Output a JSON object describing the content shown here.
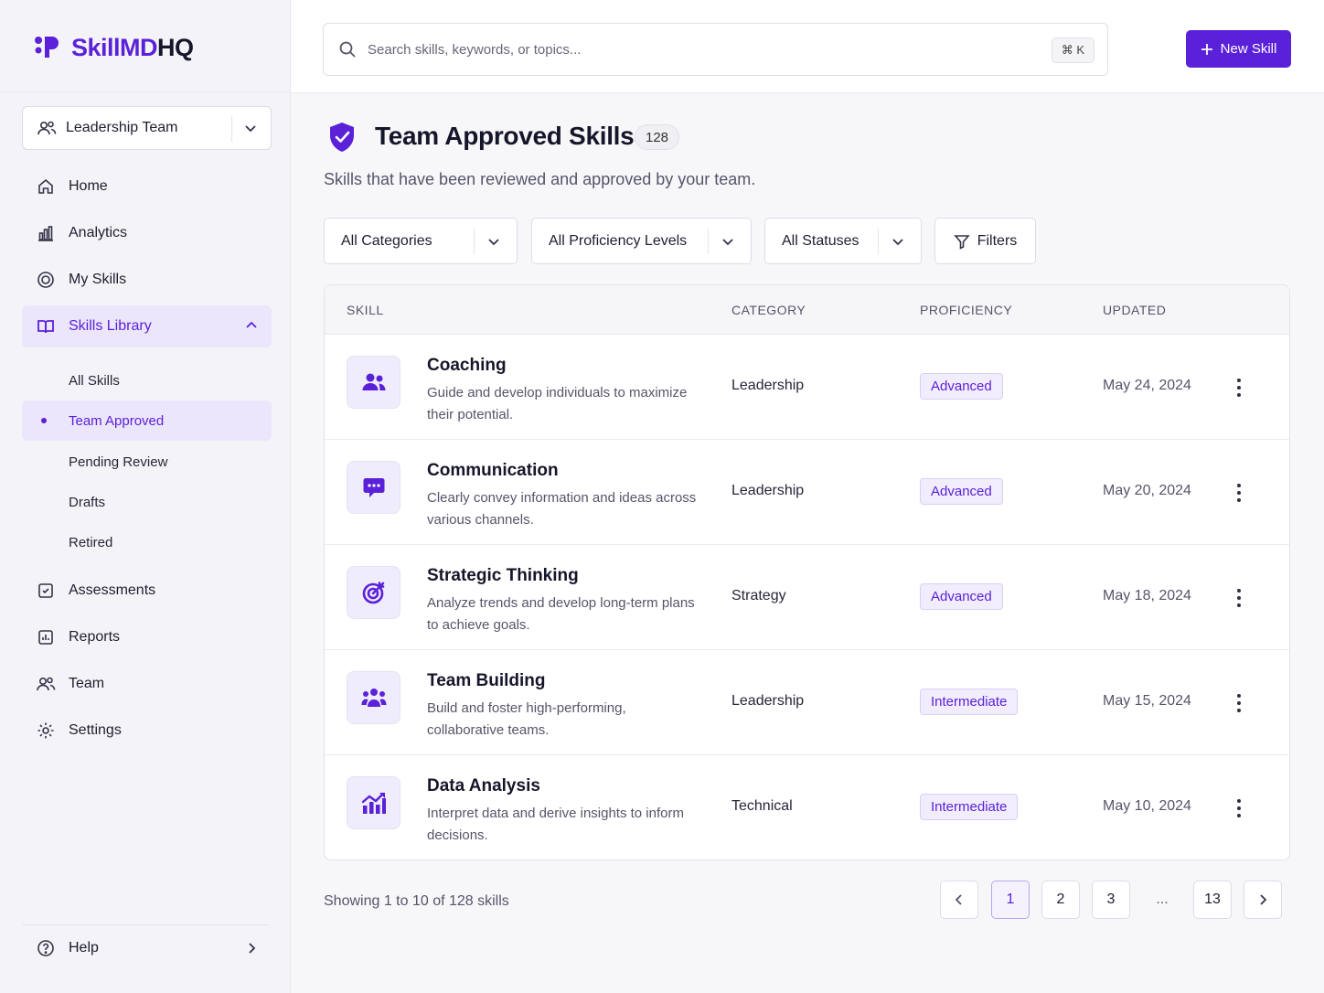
{
  "brand": {
    "name_part1": "SkillMD",
    "name_part2": "HQ"
  },
  "team_selector": {
    "value": "Leadership Team"
  },
  "nav": {
    "home": "Home",
    "analytics": "Analytics",
    "my_skills": "My Skills",
    "skills_library": "Skills Library",
    "sub": {
      "all_skills": "All Skills",
      "team_approved": "Team Approved",
      "pending_review": "Pending Review",
      "drafts": "Drafts",
      "retired": "Retired"
    },
    "assessments": "Assessments",
    "reports": "Reports",
    "team": "Team",
    "settings": "Settings",
    "help": "Help"
  },
  "search": {
    "placeholder": "Search skills, keywords, or topics...",
    "shortcut": "⌘ K"
  },
  "new_skill_label": "New Skill",
  "header": {
    "title": "Team Approved Skills",
    "count": "128",
    "subtitle": "Skills that have been reviewed and approved by your team."
  },
  "filters": {
    "categories": "All Categories",
    "proficiency": "All Proficiency Levels",
    "statuses": "All Statuses",
    "filters_label": "Filters"
  },
  "table": {
    "columns": {
      "skill": "SKILL",
      "category": "CATEGORY",
      "proficiency": "PROFICIENCY",
      "updated": "UPDATED"
    },
    "rows": [
      {
        "icon": "users-icon",
        "name": "Coaching",
        "desc": "Guide and develop individuals to maximize their potential.",
        "category": "Leadership",
        "proficiency": "Advanced",
        "updated": "May 24, 2024"
      },
      {
        "icon": "chat-icon",
        "name": "Communication",
        "desc": "Clearly convey information and ideas across various channels.",
        "category": "Leadership",
        "proficiency": "Advanced",
        "updated": "May 20, 2024"
      },
      {
        "icon": "target-icon",
        "name": "Strategic Thinking",
        "desc": "Analyze trends and develop long-term plans to achieve goals.",
        "category": "Strategy",
        "proficiency": "Advanced",
        "updated": "May 18, 2024"
      },
      {
        "icon": "team-icon",
        "name": "Team Building",
        "desc": "Build and foster high-performing, collaborative teams.",
        "category": "Leadership",
        "proficiency": "Intermediate",
        "updated": "May 15, 2024"
      },
      {
        "icon": "chart-icon",
        "name": "Data Analysis",
        "desc": "Interpret data and derive insights to inform decisions.",
        "category": "Technical",
        "proficiency": "Intermediate",
        "updated": "May 10, 2024"
      }
    ]
  },
  "pagination": {
    "showing": "Showing 1 to 10 of 128 skills",
    "pages": [
      "1",
      "2",
      "3"
    ],
    "ellipsis": "...",
    "last": "13"
  },
  "colors": {
    "accent": "#5b21d9",
    "accent_bg": "#ebe6fb"
  }
}
